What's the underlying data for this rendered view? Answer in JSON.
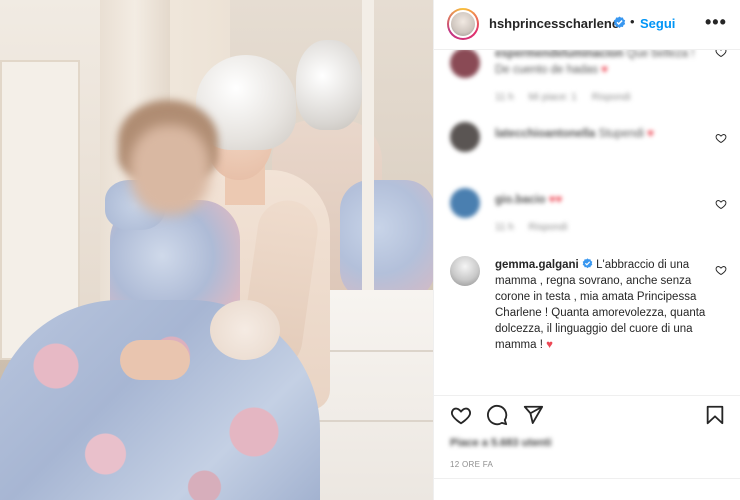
{
  "post": {
    "username": "hshprincesscharlene",
    "follow_label": "Segui",
    "more_label": "•••",
    "separator": "•",
    "likes_text": "Piace a 5.683 utenti",
    "timestamp": "12 ORE FA"
  },
  "comments": [
    {
      "user": "espermendeluminacion",
      "text": "Que belleza ! De cuento de hadas",
      "time": "11 h",
      "likes": "Mi piace: 1",
      "reply": "Rispondi",
      "blurred": true
    },
    {
      "user": "latecchioantonella",
      "text": "Stupendi",
      "time": "",
      "likes": "",
      "reply": "",
      "blurred": true
    },
    {
      "user": "gio.bacio",
      "text": "",
      "time": "11 h",
      "likes": "",
      "reply": "Rispondi",
      "blurred": true
    },
    {
      "user": "gemma.galgani",
      "text": "L'abbraccio di una mamma , regna sovrano, anche senza corone in testa , mia amata Principessa Charlene ! Quanta amorevolezza, quanta dolcezza, il linguaggio del cuore di una mamma !",
      "heart": "♥",
      "blurred": false
    }
  ],
  "icons": {
    "verified": "verified-badge-icon",
    "like": "heart-icon",
    "comment": "comment-icon",
    "share": "send-icon",
    "save": "bookmark-icon"
  },
  "colors": {
    "link_blue": "#0095f6",
    "heart_red": "#ed4956",
    "meta_gray": "#8e8e8e"
  }
}
